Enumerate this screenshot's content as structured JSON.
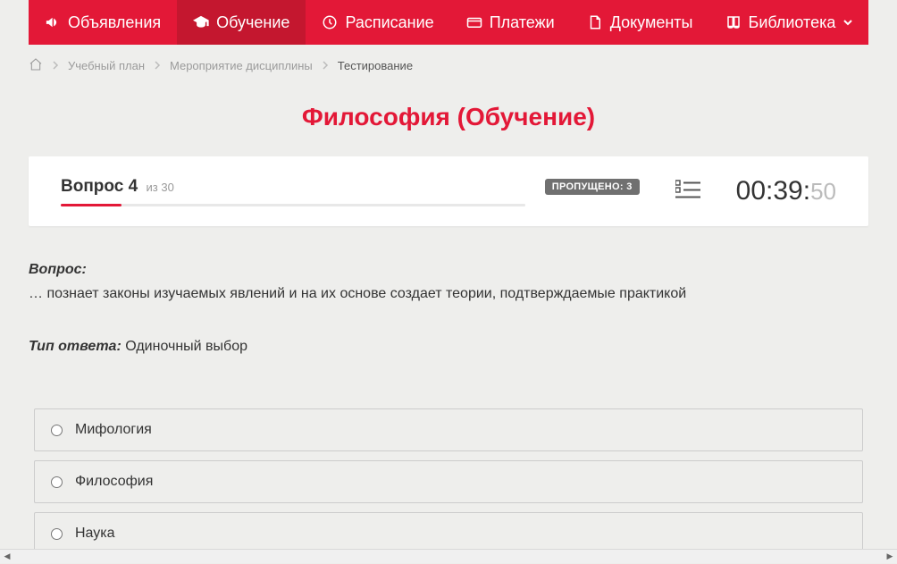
{
  "nav": {
    "items": [
      {
        "label": "Объявления",
        "icon": "megaphone"
      },
      {
        "label": "Обучение",
        "icon": "graduation",
        "active": true
      },
      {
        "label": "Расписание",
        "icon": "clock"
      },
      {
        "label": "Платежи",
        "icon": "card"
      },
      {
        "label": "Документы",
        "icon": "document"
      },
      {
        "label": "Библиотека",
        "icon": "book",
        "hasDropdown": true
      }
    ]
  },
  "breadcrumb": {
    "items": [
      {
        "label": "Учебный план"
      },
      {
        "label": "Мероприятие дисциплины"
      }
    ],
    "current": "Тестирование"
  },
  "page_title": "Философия (Обучение)",
  "quiz": {
    "question_word": "Вопрос",
    "question_num": "4",
    "total_prefix": "из",
    "total": "30",
    "skipped_label": "ПРОПУЩЕНО: 3",
    "progress_percent": 13,
    "timer": {
      "mm": "00",
      "ss": "39",
      "cs": "50"
    }
  },
  "question": {
    "label": "Вопрос:",
    "text": "… познает законы изучаемых явлений и на их основе создает теории, подтверждаемые практикой",
    "answer_type_label": "Тип ответа:",
    "answer_type_value": "Одиночный выбор",
    "options": [
      {
        "text": "Мифология"
      },
      {
        "text": "Философия"
      },
      {
        "text": "Наука"
      }
    ]
  }
}
